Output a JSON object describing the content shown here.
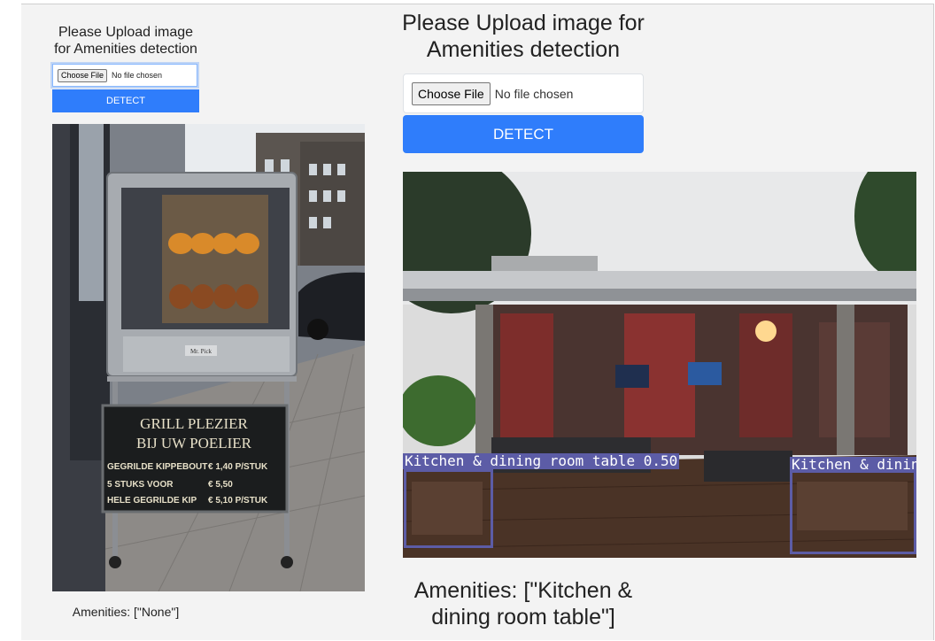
{
  "left_panel": {
    "title": "Please Upload image for Amenities detection",
    "file_button": "Choose File",
    "file_status": "No file chosen",
    "detect_button": "DETECT",
    "sign_lines": [
      "GRILL PLEZIER",
      "BIJ UW POELIER"
    ],
    "sign_items": [
      [
        "GEGRILDE KIPPEBOUT",
        "€ 1,40 P/STUK"
      ],
      [
        "5 STUKS  VOOR",
        "€ 5,50"
      ],
      [
        "HELE GEGRILDE KIP",
        "€ 5,10 P/STUK"
      ]
    ],
    "machine_brand": "Mr. Pick",
    "amenities": "Amenities: [\"None\"]"
  },
  "right_panel": {
    "title": "Please Upload image for Amenities detection",
    "file_button": "Choose File",
    "file_status": "No file chosen",
    "detect_button": "DETECT",
    "detections": [
      {
        "label": "Kitchen & dining room table 0.50"
      },
      {
        "label": "Kitchen & dining"
      }
    ],
    "amenities": "Amenities: [\"Kitchen & dining room table\"]"
  },
  "colors": {
    "detect_button": "#2f7dfb",
    "detection_box": "#5c5ca6",
    "panel_background": "#f3f3f3"
  }
}
